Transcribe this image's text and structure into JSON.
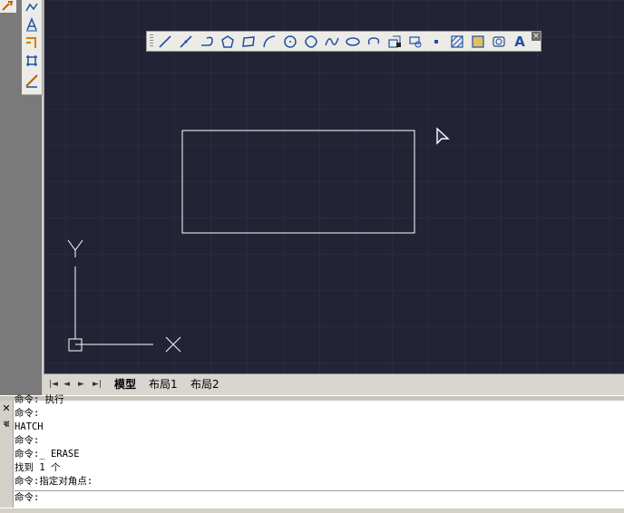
{
  "tabs": [
    "模型",
    "布局1",
    "布局2"
  ],
  "active_tab": "模型",
  "ucs": {
    "y_label": "Y",
    "x_label": "X"
  },
  "command_history": [
    "命令: 执行",
    "命令:",
    "HATCH",
    "命令:",
    "命令:_ ERASE",
    "找到 1 个",
    "命令:指定对角点:"
  ],
  "command_prompt": "命令:",
  "draw_toolbar": {
    "buttons": [
      "line-icon",
      "construction-line-icon",
      "polyline-icon",
      "polygon-icon",
      "rectangle-icon",
      "arc-icon",
      "circle-icon",
      "revcloud-icon",
      "spline-icon",
      "ellipse-icon",
      "ellipse-arc-icon",
      "insert-block-icon",
      "make-block-icon",
      "point-icon",
      "hatch-icon",
      "gradient-icon",
      "region-icon",
      "text-icon"
    ],
    "text_button_label": "A",
    "close_label": "×"
  },
  "colors": {
    "canvas_bg": "#222436",
    "grid": "#303447",
    "icon_blue": "#1f4fa8"
  }
}
